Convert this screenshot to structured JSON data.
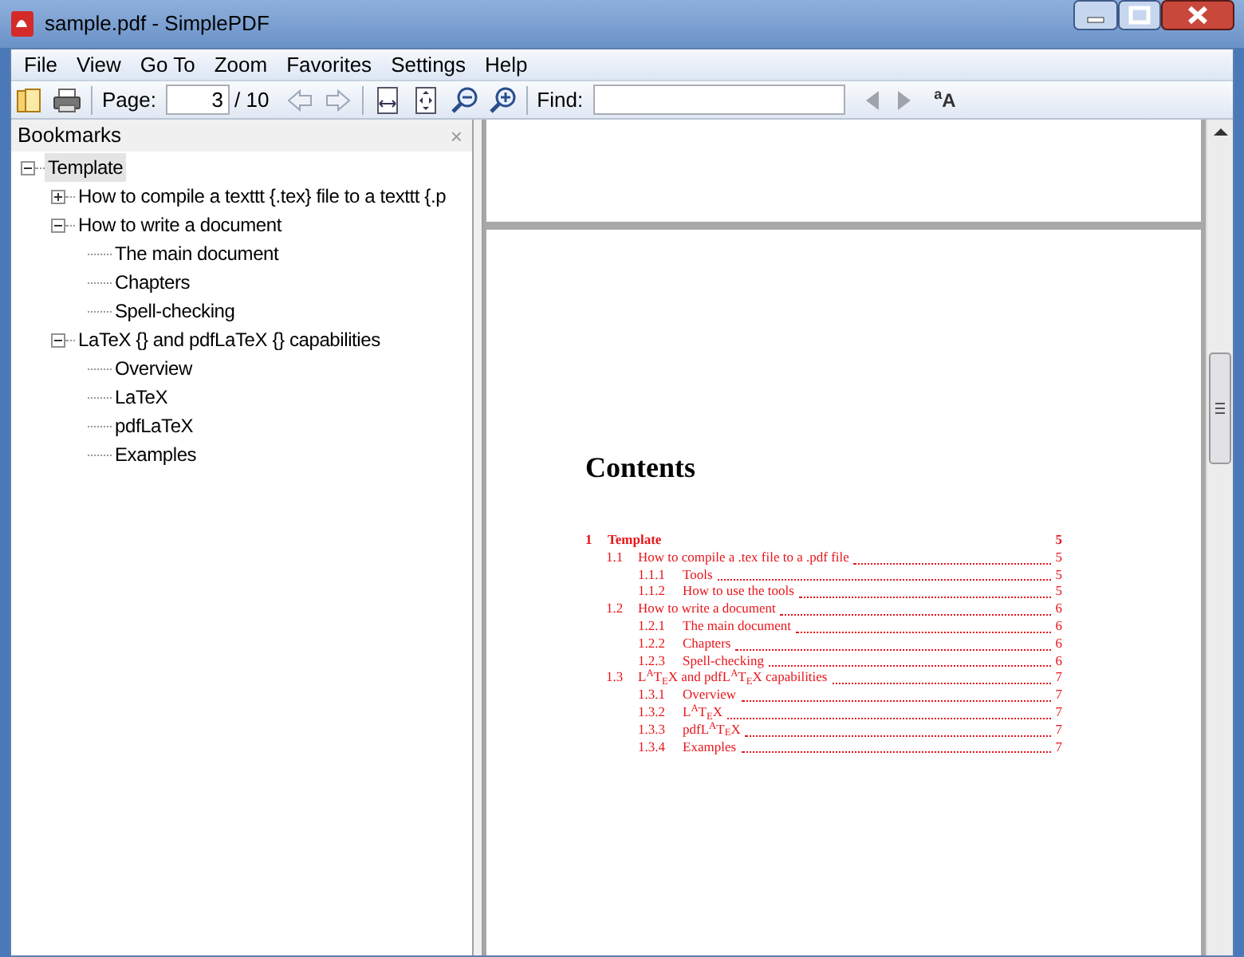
{
  "window": {
    "title": "sample.pdf - SimplePDF"
  },
  "menu": [
    "File",
    "View",
    "Go To",
    "Zoom",
    "Favorites",
    "Settings",
    "Help"
  ],
  "toolbar": {
    "page_label": "Page:",
    "page_value": "3",
    "page_total": "/ 10",
    "find_label": "Find:",
    "case_button": "$^{a}$A"
  },
  "bookmarks": {
    "title": "Bookmarks",
    "close": "×",
    "items": [
      {
        "label": "Template",
        "expanded": true,
        "selected": true,
        "children": [
          {
            "label": "How to compile a texttt {.tex} file to a texttt {.p",
            "expanded": false,
            "selected": false
          },
          {
            "label": "How to write a document",
            "expanded": true,
            "selected": false,
            "children": [
              {
                "label": "The main document",
                "selected": false
              },
              {
                "label": "Chapters",
                "selected": false
              },
              {
                "label": "Spell-checking",
                "selected": false
              }
            ]
          },
          {
            "label": "LaTeX {} and pdfLaTeX {} capabilities",
            "expanded": true,
            "selected": false,
            "children": [
              {
                "label": "Overview",
                "selected": false
              },
              {
                "label": "LaTeX",
                "selected": false
              },
              {
                "label": "pdfLaTeX",
                "selected": false
              },
              {
                "label": "Examples",
                "selected": false
              }
            ]
          }
        ]
      }
    ]
  },
  "document": {
    "heading": "Contents",
    "toc": [
      {
        "kind": "chapter",
        "number": "1",
        "title": "Template",
        "page": "5"
      },
      {
        "kind": "section",
        "number": "1.1",
        "title": "How to compile a .tex file to a .pdf file",
        "page": "5"
      },
      {
        "kind": "subsection",
        "number": "1.1.1",
        "title": "Tools",
        "page": "5"
      },
      {
        "kind": "subsection",
        "number": "1.1.2",
        "title": "How to use the tools",
        "page": "5"
      },
      {
        "kind": "section",
        "number": "1.2",
        "title": "How to write a document",
        "page": "6"
      },
      {
        "kind": "subsection",
        "number": "1.2.1",
        "title": "The main document",
        "page": "6"
      },
      {
        "kind": "subsection",
        "number": "1.2.2",
        "title": "Chapters",
        "page": "6"
      },
      {
        "kind": "subsection",
        "number": "1.2.3",
        "title": "Spell-checking",
        "page": "6"
      },
      {
        "kind": "section",
        "number": "1.3",
        "title": "L$^{A}$T$_{E}$X and pdfL$^{A}$T$_{E}$X capabilities",
        "page": "7"
      },
      {
        "kind": "subsection",
        "number": "1.3.1",
        "title": "Overview",
        "page": "7"
      },
      {
        "kind": "subsection",
        "number": "1.3.2",
        "title": "L$^{A}$T$_{E}$X",
        "page": "7"
      },
      {
        "kind": "subsection",
        "number": "1.3.3",
        "title": "pdfL$^{A}$T$_{E}$X",
        "page": "7"
      },
      {
        "kind": "subsection",
        "number": "1.3.4",
        "title": "Examples",
        "page": "7"
      }
    ]
  }
}
